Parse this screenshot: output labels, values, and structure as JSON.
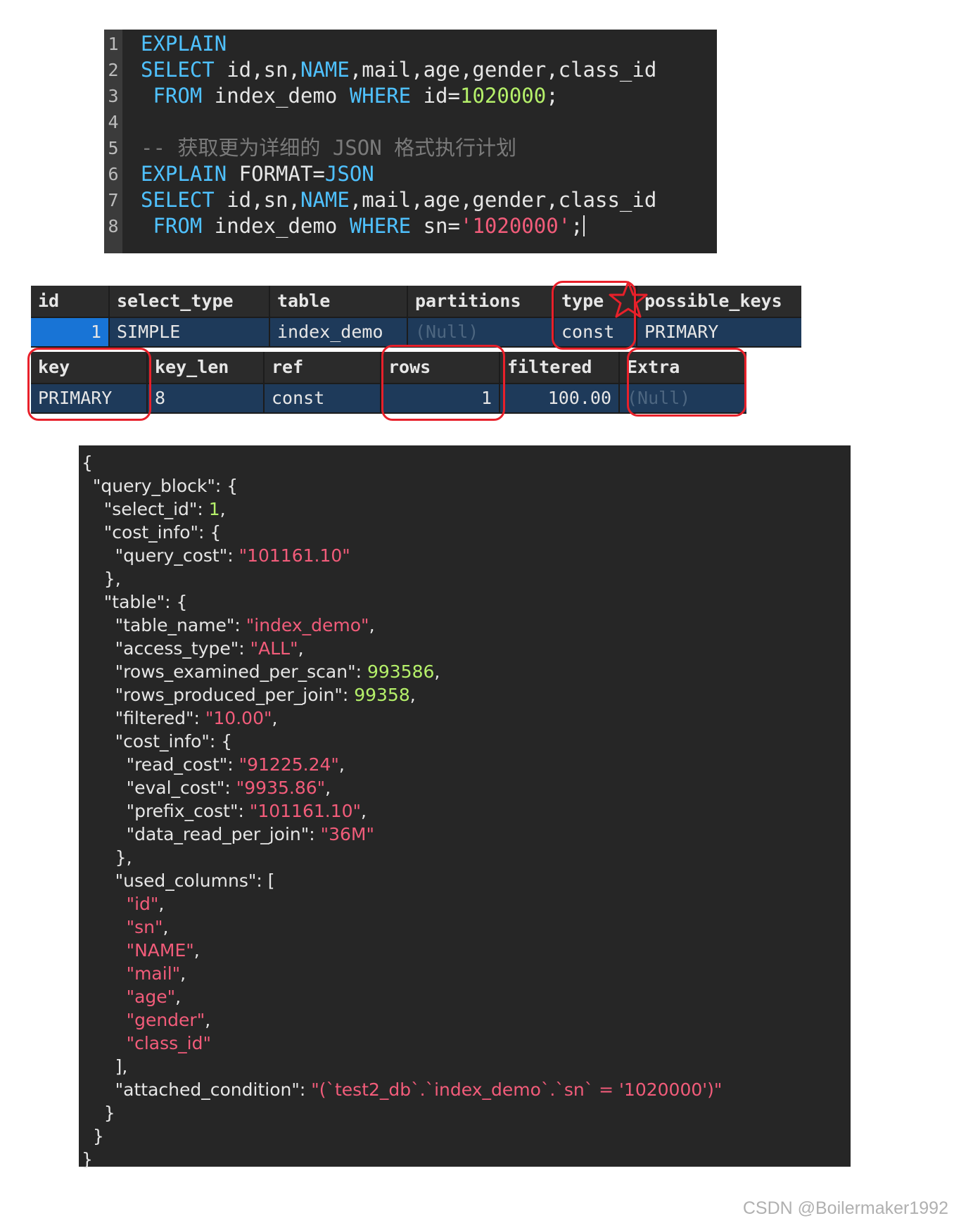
{
  "sql_editor": {
    "line_numbers": [
      "1",
      "2",
      "3",
      "4",
      "5",
      "6",
      "7",
      "8"
    ],
    "lines": [
      [
        {
          "t": "EXPLAIN",
          "c": "kw"
        }
      ],
      [
        {
          "t": "SELECT",
          "c": "kw"
        },
        {
          "t": " id,sn,",
          "c": "txt"
        },
        {
          "t": "NAME",
          "c": "kw"
        },
        {
          "t": ",mail,age,gender,class_id",
          "c": "txt"
        }
      ],
      [
        {
          "t": " ",
          "c": "txt"
        },
        {
          "t": "FROM",
          "c": "kw"
        },
        {
          "t": " index_demo ",
          "c": "txt"
        },
        {
          "t": "WHERE",
          "c": "kw"
        },
        {
          "t": " id=",
          "c": "txt"
        },
        {
          "t": "1020000",
          "c": "num"
        },
        {
          "t": ";",
          "c": "txt"
        }
      ],
      [],
      [
        {
          "t": "-- 获取更为详细的 JSON 格式执行计划",
          "c": "cmt"
        }
      ],
      [
        {
          "t": "EXPLAIN",
          "c": "kw"
        },
        {
          "t": " FORMAT=",
          "c": "txt"
        },
        {
          "t": "JSON",
          "c": "kw"
        }
      ],
      [
        {
          "t": "SELECT",
          "c": "kw"
        },
        {
          "t": " id,sn,",
          "c": "txt"
        },
        {
          "t": "NAME",
          "c": "kw"
        },
        {
          "t": ",mail,age,gender,class_id",
          "c": "txt"
        }
      ],
      [
        {
          "t": " ",
          "c": "txt"
        },
        {
          "t": "FROM",
          "c": "kw"
        },
        {
          "t": " index_demo ",
          "c": "txt"
        },
        {
          "t": "WHERE",
          "c": "kw"
        },
        {
          "t": " sn=",
          "c": "txt"
        },
        {
          "t": "'1020000'",
          "c": "str"
        },
        {
          "t": ";",
          "c": "txt"
        }
      ]
    ]
  },
  "explain_grid_1": {
    "headers": [
      "id",
      "select_type",
      "table",
      "partitions",
      "type",
      "possible_keys"
    ],
    "row": [
      "1",
      "SIMPLE",
      "index_demo",
      "(Null)",
      "const",
      "PRIMARY"
    ]
  },
  "explain_grid_2": {
    "headers": [
      "key",
      "key_len",
      "ref",
      "rows",
      "filtered",
      "Extra"
    ],
    "row": [
      "PRIMARY",
      "8",
      "const",
      "1",
      "100.00",
      "(Null)"
    ]
  },
  "json_output": {
    "lines": [
      [
        {
          "t": "{",
          "c": "txt"
        }
      ],
      [
        {
          "t": "  \"query_block\": {",
          "c": "txt"
        }
      ],
      [
        {
          "t": "    \"select_id\": ",
          "c": "txt"
        },
        {
          "t": "1",
          "c": "num"
        },
        {
          "t": ",",
          "c": "txt"
        }
      ],
      [
        {
          "t": "    \"cost_info\": {",
          "c": "txt"
        }
      ],
      [
        {
          "t": "      \"query_cost\": ",
          "c": "txt"
        },
        {
          "t": "\"101161.10\"",
          "c": "str"
        }
      ],
      [
        {
          "t": "    },",
          "c": "txt"
        }
      ],
      [
        {
          "t": "    \"table\": {",
          "c": "txt"
        }
      ],
      [
        {
          "t": "      \"table_name\": ",
          "c": "txt"
        },
        {
          "t": "\"index_demo\"",
          "c": "str"
        },
        {
          "t": ",",
          "c": "txt"
        }
      ],
      [
        {
          "t": "      \"access_type\": ",
          "c": "txt"
        },
        {
          "t": "\"ALL\"",
          "c": "str"
        },
        {
          "t": ",",
          "c": "txt"
        }
      ],
      [
        {
          "t": "      \"rows_examined_per_scan\": ",
          "c": "txt"
        },
        {
          "t": "993586",
          "c": "num"
        },
        {
          "t": ",",
          "c": "txt"
        }
      ],
      [
        {
          "t": "      \"rows_produced_per_join\": ",
          "c": "txt"
        },
        {
          "t": "99358",
          "c": "num"
        },
        {
          "t": ",",
          "c": "txt"
        }
      ],
      [
        {
          "t": "      \"filtered\": ",
          "c": "txt"
        },
        {
          "t": "\"10.00\"",
          "c": "str"
        },
        {
          "t": ",",
          "c": "txt"
        }
      ],
      [
        {
          "t": "      \"cost_info\": {",
          "c": "txt"
        }
      ],
      [
        {
          "t": "        \"read_cost\": ",
          "c": "txt"
        },
        {
          "t": "\"91225.24\"",
          "c": "str"
        },
        {
          "t": ",",
          "c": "txt"
        }
      ],
      [
        {
          "t": "        \"eval_cost\": ",
          "c": "txt"
        },
        {
          "t": "\"9935.86\"",
          "c": "str"
        },
        {
          "t": ",",
          "c": "txt"
        }
      ],
      [
        {
          "t": "        \"prefix_cost\": ",
          "c": "txt"
        },
        {
          "t": "\"101161.10\"",
          "c": "str"
        },
        {
          "t": ",",
          "c": "txt"
        }
      ],
      [
        {
          "t": "        \"data_read_per_join\": ",
          "c": "txt"
        },
        {
          "t": "\"36M\"",
          "c": "str"
        }
      ],
      [
        {
          "t": "      },",
          "c": "txt"
        }
      ],
      [
        {
          "t": "      \"used_columns\": [",
          "c": "txt"
        }
      ],
      [
        {
          "t": "        ",
          "c": "txt"
        },
        {
          "t": "\"id\"",
          "c": "str"
        },
        {
          "t": ",",
          "c": "txt"
        }
      ],
      [
        {
          "t": "        ",
          "c": "txt"
        },
        {
          "t": "\"sn\"",
          "c": "str"
        },
        {
          "t": ",",
          "c": "txt"
        }
      ],
      [
        {
          "t": "        ",
          "c": "txt"
        },
        {
          "t": "\"NAME\"",
          "c": "str"
        },
        {
          "t": ",",
          "c": "txt"
        }
      ],
      [
        {
          "t": "        ",
          "c": "txt"
        },
        {
          "t": "\"mail\"",
          "c": "str"
        },
        {
          "t": ",",
          "c": "txt"
        }
      ],
      [
        {
          "t": "        ",
          "c": "txt"
        },
        {
          "t": "\"age\"",
          "c": "str"
        },
        {
          "t": ",",
          "c": "txt"
        }
      ],
      [
        {
          "t": "        ",
          "c": "txt"
        },
        {
          "t": "\"gender\"",
          "c": "str"
        },
        {
          "t": ",",
          "c": "txt"
        }
      ],
      [
        {
          "t": "        ",
          "c": "txt"
        },
        {
          "t": "\"class_id\"",
          "c": "str"
        }
      ],
      [
        {
          "t": "      ],",
          "c": "txt"
        }
      ],
      [
        {
          "t": "      \"attached_condition\": ",
          "c": "txt"
        },
        {
          "t": "\"(`test2_db`.`index_demo`.`sn` = '1020000')\"",
          "c": "str"
        }
      ],
      [
        {
          "t": "    }",
          "c": "txt"
        }
      ],
      [
        {
          "t": "  }",
          "c": "txt"
        }
      ],
      [
        {
          "t": "}",
          "c": "txt"
        }
      ]
    ]
  },
  "watermark": "CSDN @Boilermaker1992",
  "colors": {
    "keyword": "#4fc1ff",
    "number": "#b5f06a",
    "string": "#f25c7a",
    "comment": "#7a7a7a",
    "highlight": "#e8202a",
    "row_bg": "#1e3a5a",
    "selected_cell": "#1874d6"
  }
}
